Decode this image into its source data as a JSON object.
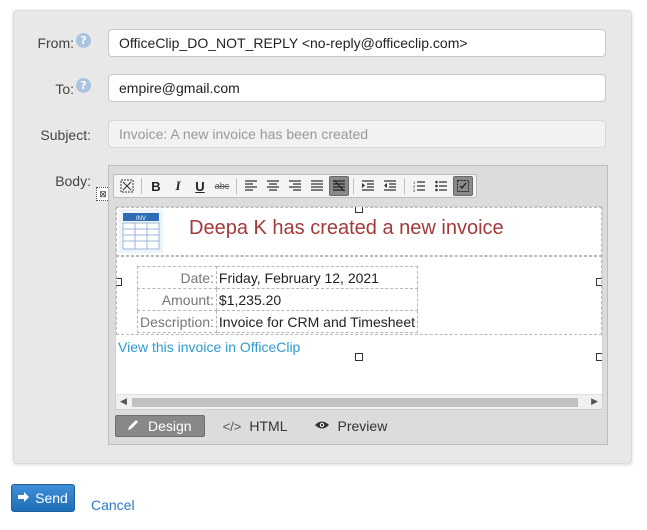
{
  "form": {
    "from_label": "From:",
    "from_value": "OfficeClip_DO_NOT_REPLY <no-reply@officeclip.com>",
    "to_label": "To:",
    "to_value": "empire@gmail.com",
    "subject_label": "Subject:",
    "subject_value": "Invoice: A new invoice has been created",
    "body_label": "Body:",
    "help_glyph": "?"
  },
  "toolbar": {
    "bold": "B",
    "italic": "I",
    "underline": "U",
    "strike": "abc"
  },
  "body": {
    "heading": "Deepa K has created a new invoice",
    "thumb_label": "INV",
    "rows": [
      {
        "label": "Date:",
        "value": "Friday, February 12, 2021"
      },
      {
        "label": "Amount:",
        "value": "$1,235.20"
      },
      {
        "label": "Description:",
        "value": "Invoice for CRM and Timesheet"
      }
    ],
    "link": "View this invoice in OfficeClip"
  },
  "modes": {
    "design": "Design",
    "html": "HTML",
    "preview": "Preview"
  },
  "actions": {
    "send": "Send",
    "cancel": "Cancel"
  }
}
